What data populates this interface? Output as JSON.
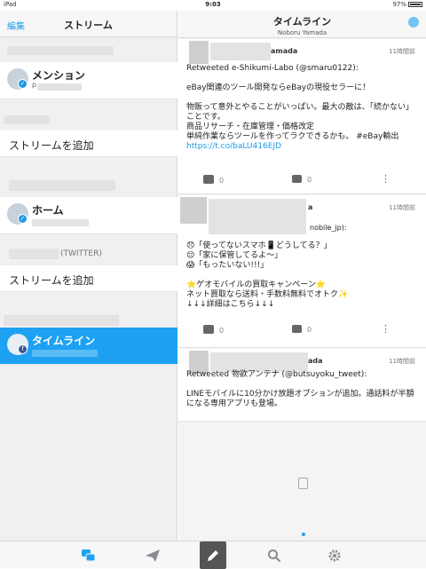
{
  "statusbar": {
    "device": "iPad",
    "time": "9:03",
    "battery": "97%"
  },
  "left": {
    "edit": "編集",
    "title": "ストリーム",
    "twitter_section_suffix": "(TWITTER)",
    "mention": {
      "name": "メンション",
      "sub": "p"
    },
    "add_stream_1": "ストリームを追加",
    "home": {
      "name": "ホーム"
    },
    "add_stream_2": "ストリームを追加",
    "timeline": {
      "name": "タイムライン"
    }
  },
  "right": {
    "title": "タイムライン",
    "subtitle": "Noboru Yamada",
    "tweets": [
      {
        "uname": "amada",
        "time": "11時間前",
        "text": "Retweeted e-Shikumi-Labo (@smaru0122):\n\neBay関連のツール開発ならeBayの現役セラーに！\n\n物販って意外とやることがいっぱい。最大の敵は、「続かない」ことです。\n商品リサーチ・在庫管理・価格改定\n単純作業ならツールを作ってラクできるかも。 #eBay輸出",
        "link": "https://t.co/baLU416EJD",
        "likes": "0",
        "comments": "0"
      },
      {
        "uname": "a",
        "time": "11時間前",
        "handle": "nobile_jp):",
        "text": "😞「使ってないスマホ📱どうしてる？」\n😔「家に保管してるよ〜」\n😱「もったいない!!!」\n\n⭐ゲオモバイルの買取キャンペーン⭐\nネット買取なら送料・手数料無料でオトク✨\n↓↓↓詳細はこちら↓↓↓",
        "likes": "0",
        "comments": "0"
      },
      {
        "uname": "ada",
        "time": "11時間前",
        "text": "Retweeted 物欲アンテナ (@butsuyoku_tweet):\n\nLINEモバイルに10分かけ放題オプションが追加。通話料が半額になる専用アプリも登場。"
      }
    ]
  },
  "tabs": [
    "streams",
    "send",
    "compose",
    "search",
    "settings"
  ],
  "colors": {
    "accent": "#1ea1f2",
    "selected_row": "#1ea1f2"
  }
}
